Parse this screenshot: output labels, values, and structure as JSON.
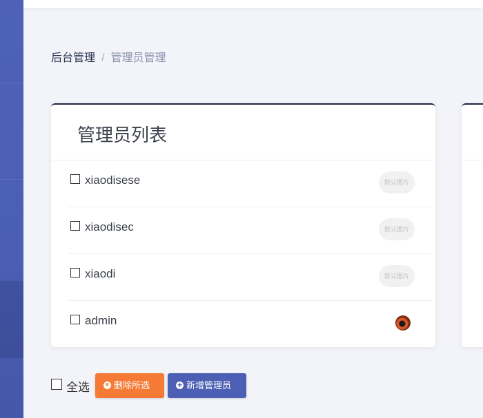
{
  "breadcrumb": {
    "root": "后台管理",
    "separator": "/",
    "current": "管理员管理"
  },
  "card": {
    "title": "管理员列表"
  },
  "admins": [
    {
      "name": "xiaodisese",
      "avatar_text": "默认图片"
    },
    {
      "name": "xiaodisec",
      "avatar_text": "默认图片"
    },
    {
      "name": "xiaodi",
      "avatar_text": "默认图片"
    },
    {
      "name": "admin",
      "avatar_text": ""
    }
  ],
  "footer": {
    "select_all_label": "全选",
    "delete_selected_label": "删除所选",
    "add_admin_label": "新增管理员"
  },
  "colors": {
    "sidebar": "#4d62b6",
    "delete_button": "#f47a36",
    "add_button": "#4c5fb4"
  }
}
